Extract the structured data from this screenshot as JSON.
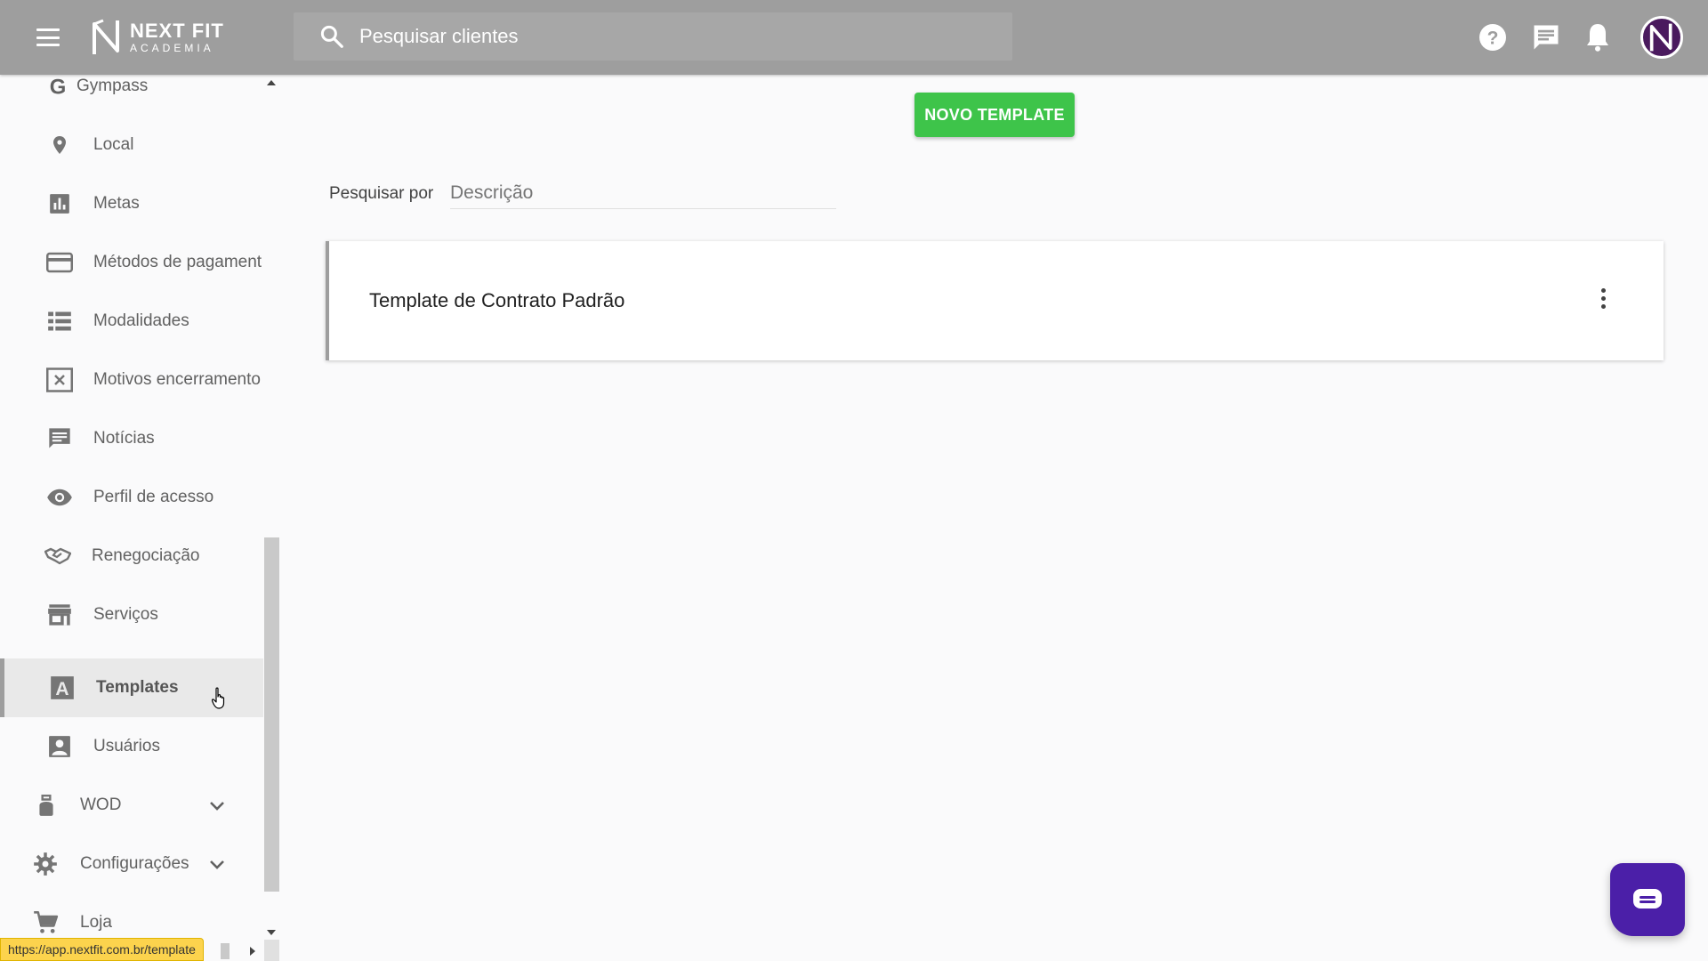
{
  "header": {
    "logo_line1": "NEXT FIT",
    "logo_line2": "ACADEMIA",
    "search_placeholder": "Pesquisar clientes",
    "icons": [
      "menu-icon",
      "search-icon",
      "help-icon",
      "chat-icon",
      "bell-icon"
    ]
  },
  "sidebar": {
    "items": [
      {
        "label": "Gympass",
        "icon": "gympass-icon"
      },
      {
        "label": "Local",
        "icon": "location-pin-icon"
      },
      {
        "label": "Metas",
        "icon": "bar-chart-icon"
      },
      {
        "label": "Métodos de pagamento",
        "icon": "credit-card-icon"
      },
      {
        "label": "Modalidades",
        "icon": "list-icon"
      },
      {
        "label": "Motivos encerramento",
        "icon": "close-box-icon"
      },
      {
        "label": "Notícias",
        "icon": "message-icon"
      },
      {
        "label": "Perfil de acesso",
        "icon": "eye-icon"
      },
      {
        "label": "Renegociação",
        "icon": "handshake-icon"
      },
      {
        "label": "Serviços",
        "icon": "store-icon"
      },
      {
        "label": "Templates",
        "icon": "text-a-icon",
        "active": true
      },
      {
        "label": "Usuários",
        "icon": "account-box-icon"
      },
      {
        "label": "WOD",
        "icon": "kettlebell-icon"
      },
      {
        "label": "Configurações",
        "icon": "gear-icon"
      },
      {
        "label": "Loja",
        "icon": "cart-icon"
      }
    ]
  },
  "main": {
    "new_button": "NOVO TEMPLATE",
    "search_by_label": "Pesquisar por",
    "description_placeholder": "Descrição",
    "templates": [
      {
        "title": "Template de Contrato Padrão"
      }
    ]
  },
  "status_bar": {
    "url": "https://app.nextfit.com.br/template"
  },
  "colors": {
    "topbar": "#9e9e9e",
    "primary_button": "#3ec44a",
    "chat_fab": "#4b1fa8",
    "avatar": "#4a1a5e"
  }
}
